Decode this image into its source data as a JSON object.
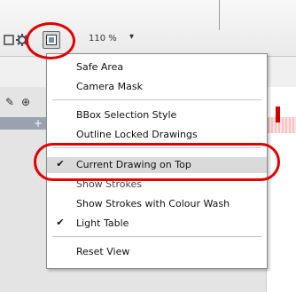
{
  "toolbar": {
    "zoom": "110 %",
    "zoom_dropdown_icon": "triangle-down-icon",
    "icons": [
      "tool-icon-left",
      "gear-icon",
      "view-options-icon"
    ]
  },
  "menu": {
    "items": [
      {
        "label": "Safe Area",
        "checked": false
      },
      {
        "label": "Camera Mask",
        "checked": false
      },
      {
        "label": "BBox Selection Style",
        "checked": false
      },
      {
        "label": "Outline Locked Drawings",
        "checked": false
      },
      {
        "label": "Current Drawing on Top",
        "checked": true,
        "highlighted": true
      },
      {
        "label": "Show Strokes",
        "checked": false
      },
      {
        "label": "Show Strokes with Colour Wash",
        "checked": false
      },
      {
        "label": "Light Table",
        "checked": true
      },
      {
        "label": "Reset View",
        "checked": false
      }
    ],
    "check_glyph": "✔"
  },
  "annotations": {
    "ring_color": "#e00000"
  },
  "colors": {
    "highlight": "#dadada",
    "timeline_marker": "#d00000"
  }
}
